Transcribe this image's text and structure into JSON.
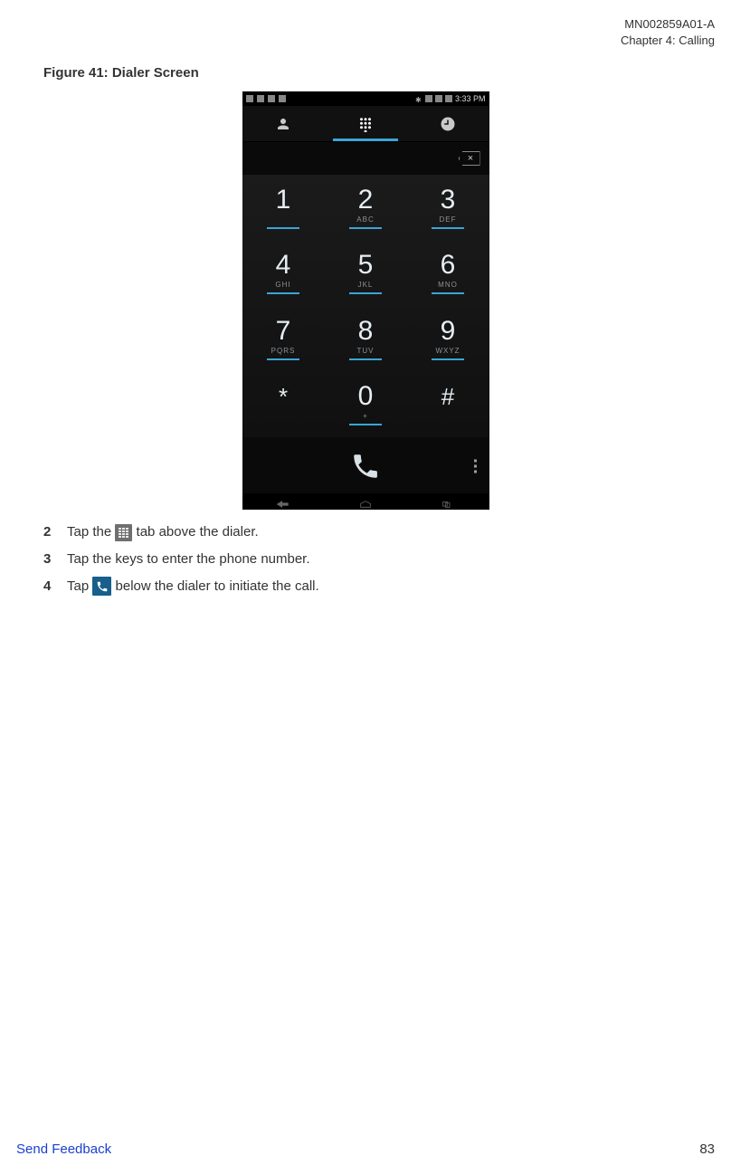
{
  "header": {
    "doc_id": "MN002859A01-A",
    "chapter": "Chapter 4:  Calling"
  },
  "figure": {
    "caption": "Figure 41: Dialer Screen"
  },
  "phone": {
    "status_time": "3:33 PM",
    "keys": [
      {
        "digit": "1",
        "letters": ""
      },
      {
        "digit": "2",
        "letters": "ABC"
      },
      {
        "digit": "3",
        "letters": "DEF"
      },
      {
        "digit": "4",
        "letters": "GHI"
      },
      {
        "digit": "5",
        "letters": "JKL"
      },
      {
        "digit": "6",
        "letters": "MNO"
      },
      {
        "digit": "7",
        "letters": "PQRS"
      },
      {
        "digit": "8",
        "letters": "TUV"
      },
      {
        "digit": "9",
        "letters": "WXYZ"
      },
      {
        "digit": "*",
        "letters": ""
      },
      {
        "digit": "0",
        "letters": "+"
      },
      {
        "digit": "#",
        "letters": ""
      }
    ]
  },
  "steps": {
    "s2": {
      "num": "2",
      "pre": "Tap the ",
      "post": " tab above the dialer."
    },
    "s3": {
      "num": "3",
      "text": "Tap the keys to enter the phone number."
    },
    "s4": {
      "num": "4",
      "pre": "Tap ",
      "post": " below the dialer to initiate the call."
    }
  },
  "footer": {
    "link": "Send Feedback",
    "page": "83"
  }
}
